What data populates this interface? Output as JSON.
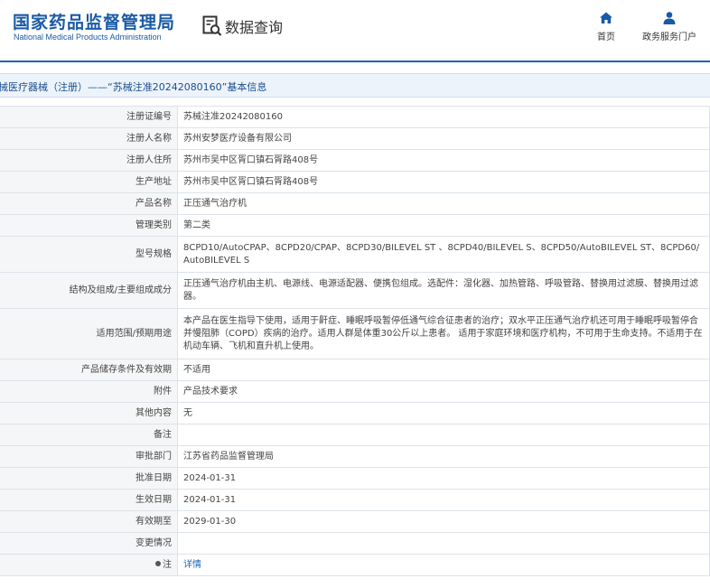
{
  "header": {
    "logo_cn": "国家药品监督管理局",
    "logo_en": "National Medical Products Administration",
    "query_label": "数据查询",
    "nav": [
      {
        "label": "首页",
        "icon": "home-icon"
      },
      {
        "label": "政务服务门户",
        "icon": "user-icon"
      }
    ],
    "accent_color": "#1e66b5"
  },
  "title": "▶医疗器械（注册）——“苏械注准20242080160”基本信息",
  "title_visible": "械医疗器械（注册）——“苏械注准20242080160”基本信息",
  "rows": [
    {
      "key": "注册证编号",
      "value": "苏械注准20242080160"
    },
    {
      "key": "注册人名称",
      "value": "苏州安梦医疗设备有限公司"
    },
    {
      "key": "注册人住所",
      "value": "苏州市吴中区胥口镇石胥路408号"
    },
    {
      "key": "生产地址",
      "value": "苏州市吴中区胥口镇石胥路408号"
    },
    {
      "key": "产品名称",
      "value": "正压通气治疗机"
    },
    {
      "key": "管理类别",
      "value": "第二类"
    },
    {
      "key": "型号规格",
      "value": "8CPD10/AutoCPAP、8CPD20/CPAP、8CPD30/BILEVEL ST 、8CPD40/BILEVEL S、8CPD50/AutoBILEVEL ST、8CPD60/AutoBILEVEL S"
    },
    {
      "key": "结构及组成/主要组成成分",
      "value": "正压通气治疗机由主机、电源线、电源适配器、便携包组成。选配件：湿化器、加热管路、呼吸管路、替换用过滤膜、替换用过滤器。"
    },
    {
      "key": "适用范围/预期用途",
      "value": "本产品在医生指导下使用，适用于鼾症、睡眠呼吸暂停低通气综合征患者的治疗；双水平正压通气治疗机还可用于睡眠呼吸暂停合并慢阻肺（COPD）疾病的治疗。适用人群是体重30公斤以上患者。 适用于家庭环境和医疗机构，不可用于生命支持。不适用于在机动车辆、飞机和直升机上使用。"
    },
    {
      "key": "产品储存条件及有效期",
      "value": "不适用"
    },
    {
      "key": "附件",
      "value": "产品技术要求"
    },
    {
      "key": "其他内容",
      "value": "无"
    },
    {
      "key": "备注",
      "value": ""
    },
    {
      "key": "审批部门",
      "value": "江苏省药品监督管理局"
    },
    {
      "key": "批准日期",
      "value": "2024-01-31"
    },
    {
      "key": "生效日期",
      "value": "2024-01-31"
    },
    {
      "key": "有效期至",
      "value": "2029-01-30"
    },
    {
      "key": "变更情况",
      "value": ""
    },
    {
      "key": "注",
      "value": "详情"
    }
  ]
}
